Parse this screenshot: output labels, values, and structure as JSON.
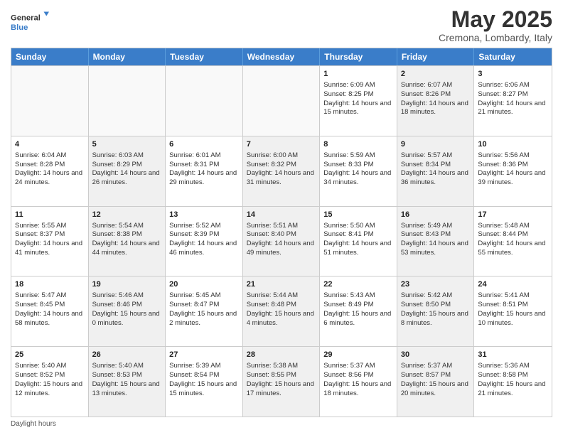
{
  "logo": {
    "general": "General",
    "blue": "Blue"
  },
  "title": "May 2025",
  "location": "Cremona, Lombardy, Italy",
  "days_of_week": [
    "Sunday",
    "Monday",
    "Tuesday",
    "Wednesday",
    "Thursday",
    "Friday",
    "Saturday"
  ],
  "footer": {
    "daylight_label": "Daylight hours"
  },
  "weeks": [
    [
      {
        "day": "",
        "sunrise": "",
        "sunset": "",
        "daylight": "",
        "shaded": false,
        "empty": true
      },
      {
        "day": "",
        "sunrise": "",
        "sunset": "",
        "daylight": "",
        "shaded": false,
        "empty": true
      },
      {
        "day": "",
        "sunrise": "",
        "sunset": "",
        "daylight": "",
        "shaded": false,
        "empty": true
      },
      {
        "day": "",
        "sunrise": "",
        "sunset": "",
        "daylight": "",
        "shaded": false,
        "empty": true
      },
      {
        "day": "1",
        "sunrise": "Sunrise: 6:09 AM",
        "sunset": "Sunset: 8:25 PM",
        "daylight": "Daylight: 14 hours and 15 minutes.",
        "shaded": false,
        "empty": false
      },
      {
        "day": "2",
        "sunrise": "Sunrise: 6:07 AM",
        "sunset": "Sunset: 8:26 PM",
        "daylight": "Daylight: 14 hours and 18 minutes.",
        "shaded": true,
        "empty": false
      },
      {
        "day": "3",
        "sunrise": "Sunrise: 6:06 AM",
        "sunset": "Sunset: 8:27 PM",
        "daylight": "Daylight: 14 hours and 21 minutes.",
        "shaded": false,
        "empty": false
      }
    ],
    [
      {
        "day": "4",
        "sunrise": "Sunrise: 6:04 AM",
        "sunset": "Sunset: 8:28 PM",
        "daylight": "Daylight: 14 hours and 24 minutes.",
        "shaded": false,
        "empty": false
      },
      {
        "day": "5",
        "sunrise": "Sunrise: 6:03 AM",
        "sunset": "Sunset: 8:29 PM",
        "daylight": "Daylight: 14 hours and 26 minutes.",
        "shaded": true,
        "empty": false
      },
      {
        "day": "6",
        "sunrise": "Sunrise: 6:01 AM",
        "sunset": "Sunset: 8:31 PM",
        "daylight": "Daylight: 14 hours and 29 minutes.",
        "shaded": false,
        "empty": false
      },
      {
        "day": "7",
        "sunrise": "Sunrise: 6:00 AM",
        "sunset": "Sunset: 8:32 PM",
        "daylight": "Daylight: 14 hours and 31 minutes.",
        "shaded": true,
        "empty": false
      },
      {
        "day": "8",
        "sunrise": "Sunrise: 5:59 AM",
        "sunset": "Sunset: 8:33 PM",
        "daylight": "Daylight: 14 hours and 34 minutes.",
        "shaded": false,
        "empty": false
      },
      {
        "day": "9",
        "sunrise": "Sunrise: 5:57 AM",
        "sunset": "Sunset: 8:34 PM",
        "daylight": "Daylight: 14 hours and 36 minutes.",
        "shaded": true,
        "empty": false
      },
      {
        "day": "10",
        "sunrise": "Sunrise: 5:56 AM",
        "sunset": "Sunset: 8:36 PM",
        "daylight": "Daylight: 14 hours and 39 minutes.",
        "shaded": false,
        "empty": false
      }
    ],
    [
      {
        "day": "11",
        "sunrise": "Sunrise: 5:55 AM",
        "sunset": "Sunset: 8:37 PM",
        "daylight": "Daylight: 14 hours and 41 minutes.",
        "shaded": false,
        "empty": false
      },
      {
        "day": "12",
        "sunrise": "Sunrise: 5:54 AM",
        "sunset": "Sunset: 8:38 PM",
        "daylight": "Daylight: 14 hours and 44 minutes.",
        "shaded": true,
        "empty": false
      },
      {
        "day": "13",
        "sunrise": "Sunrise: 5:52 AM",
        "sunset": "Sunset: 8:39 PM",
        "daylight": "Daylight: 14 hours and 46 minutes.",
        "shaded": false,
        "empty": false
      },
      {
        "day": "14",
        "sunrise": "Sunrise: 5:51 AM",
        "sunset": "Sunset: 8:40 PM",
        "daylight": "Daylight: 14 hours and 49 minutes.",
        "shaded": true,
        "empty": false
      },
      {
        "day": "15",
        "sunrise": "Sunrise: 5:50 AM",
        "sunset": "Sunset: 8:41 PM",
        "daylight": "Daylight: 14 hours and 51 minutes.",
        "shaded": false,
        "empty": false
      },
      {
        "day": "16",
        "sunrise": "Sunrise: 5:49 AM",
        "sunset": "Sunset: 8:43 PM",
        "daylight": "Daylight: 14 hours and 53 minutes.",
        "shaded": true,
        "empty": false
      },
      {
        "day": "17",
        "sunrise": "Sunrise: 5:48 AM",
        "sunset": "Sunset: 8:44 PM",
        "daylight": "Daylight: 14 hours and 55 minutes.",
        "shaded": false,
        "empty": false
      }
    ],
    [
      {
        "day": "18",
        "sunrise": "Sunrise: 5:47 AM",
        "sunset": "Sunset: 8:45 PM",
        "daylight": "Daylight: 14 hours and 58 minutes.",
        "shaded": false,
        "empty": false
      },
      {
        "day": "19",
        "sunrise": "Sunrise: 5:46 AM",
        "sunset": "Sunset: 8:46 PM",
        "daylight": "Daylight: 15 hours and 0 minutes.",
        "shaded": true,
        "empty": false
      },
      {
        "day": "20",
        "sunrise": "Sunrise: 5:45 AM",
        "sunset": "Sunset: 8:47 PM",
        "daylight": "Daylight: 15 hours and 2 minutes.",
        "shaded": false,
        "empty": false
      },
      {
        "day": "21",
        "sunrise": "Sunrise: 5:44 AM",
        "sunset": "Sunset: 8:48 PM",
        "daylight": "Daylight: 15 hours and 4 minutes.",
        "shaded": true,
        "empty": false
      },
      {
        "day": "22",
        "sunrise": "Sunrise: 5:43 AM",
        "sunset": "Sunset: 8:49 PM",
        "daylight": "Daylight: 15 hours and 6 minutes.",
        "shaded": false,
        "empty": false
      },
      {
        "day": "23",
        "sunrise": "Sunrise: 5:42 AM",
        "sunset": "Sunset: 8:50 PM",
        "daylight": "Daylight: 15 hours and 8 minutes.",
        "shaded": true,
        "empty": false
      },
      {
        "day": "24",
        "sunrise": "Sunrise: 5:41 AM",
        "sunset": "Sunset: 8:51 PM",
        "daylight": "Daylight: 15 hours and 10 minutes.",
        "shaded": false,
        "empty": false
      }
    ],
    [
      {
        "day": "25",
        "sunrise": "Sunrise: 5:40 AM",
        "sunset": "Sunset: 8:52 PM",
        "daylight": "Daylight: 15 hours and 12 minutes.",
        "shaded": false,
        "empty": false
      },
      {
        "day": "26",
        "sunrise": "Sunrise: 5:40 AM",
        "sunset": "Sunset: 8:53 PM",
        "daylight": "Daylight: 15 hours and 13 minutes.",
        "shaded": true,
        "empty": false
      },
      {
        "day": "27",
        "sunrise": "Sunrise: 5:39 AM",
        "sunset": "Sunset: 8:54 PM",
        "daylight": "Daylight: 15 hours and 15 minutes.",
        "shaded": false,
        "empty": false
      },
      {
        "day": "28",
        "sunrise": "Sunrise: 5:38 AM",
        "sunset": "Sunset: 8:55 PM",
        "daylight": "Daylight: 15 hours and 17 minutes.",
        "shaded": true,
        "empty": false
      },
      {
        "day": "29",
        "sunrise": "Sunrise: 5:37 AM",
        "sunset": "Sunset: 8:56 PM",
        "daylight": "Daylight: 15 hours and 18 minutes.",
        "shaded": false,
        "empty": false
      },
      {
        "day": "30",
        "sunrise": "Sunrise: 5:37 AM",
        "sunset": "Sunset: 8:57 PM",
        "daylight": "Daylight: 15 hours and 20 minutes.",
        "shaded": true,
        "empty": false
      },
      {
        "day": "31",
        "sunrise": "Sunrise: 5:36 AM",
        "sunset": "Sunset: 8:58 PM",
        "daylight": "Daylight: 15 hours and 21 minutes.",
        "shaded": false,
        "empty": false
      }
    ]
  ]
}
